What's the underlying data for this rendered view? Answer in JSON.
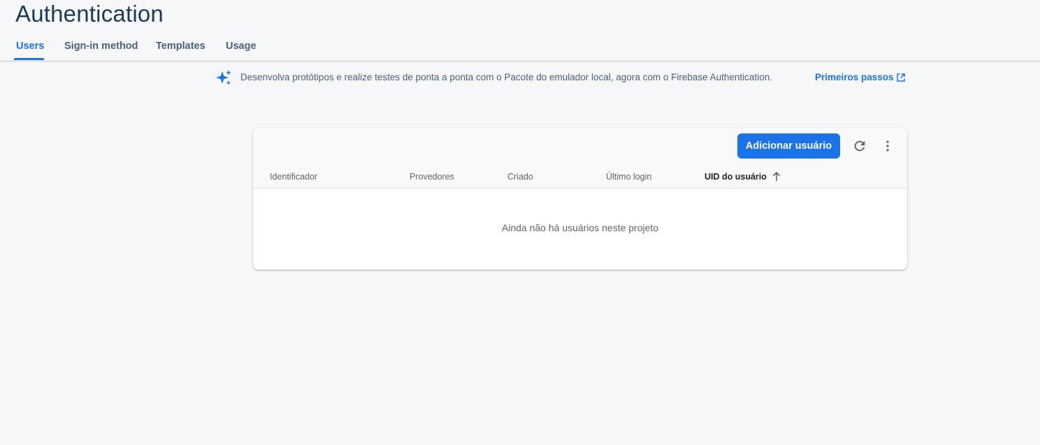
{
  "header": {
    "title": "Authentication"
  },
  "tabs": [
    {
      "label": "Users",
      "active": true
    },
    {
      "label": "Sign-in method",
      "active": false
    },
    {
      "label": "Templates",
      "active": false
    },
    {
      "label": "Usage",
      "active": false
    }
  ],
  "banner": {
    "icon": "sparkle-icon",
    "text": "Desenvolva protótipos e realize testes de ponta a ponta com o Pacote do emulador local, agora com o Firebase Authentication.",
    "link_label": "Primeiros passos",
    "link_icon": "open-in-new-icon"
  },
  "users_table": {
    "add_button_label": "Adicionar usuário",
    "refresh_icon": "refresh-icon",
    "more_icon": "more-vert-icon",
    "columns": [
      "Identificador",
      "Provedores",
      "Criado",
      "Último login",
      "UID do usuário"
    ],
    "sorted_column": "UID do usuário",
    "sort_direction": "ascending",
    "empty_message": "Ainda não há usuários neste projeto",
    "rows": []
  },
  "colors": {
    "accent": "#1a73e8",
    "title": "#1b3a57",
    "background": "#f6f7f9"
  }
}
